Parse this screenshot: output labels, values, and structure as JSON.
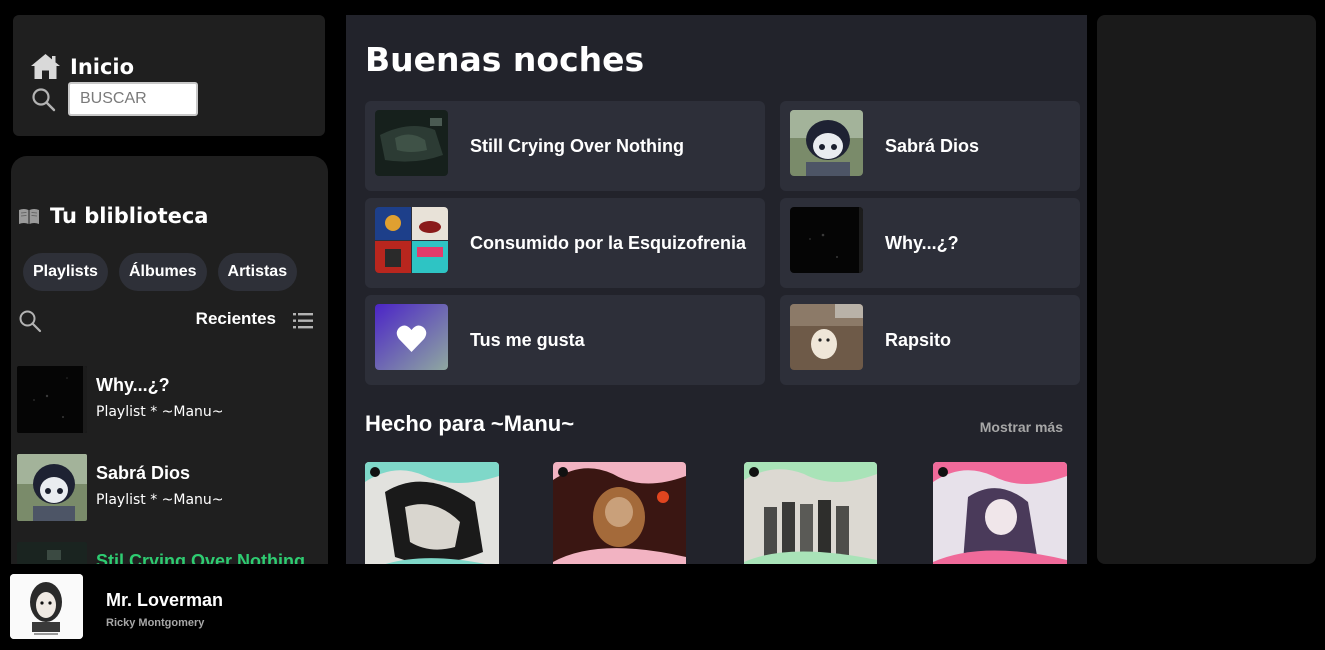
{
  "nav": {
    "home_label": "Inicio",
    "search_placeholder": "BUSCAR"
  },
  "library": {
    "title": "Tu bliblioteca",
    "filters": [
      "Playlists",
      "Álbumes",
      "Artistas"
    ],
    "sort_label": "Recientes",
    "items": [
      {
        "title": "Why...¿?",
        "subtitle": "Playlist * ~Manu~"
      },
      {
        "title": "Sabrá Dios",
        "subtitle": "Playlist * ~Manu~"
      },
      {
        "title": "Stil Crying Over Nothing",
        "subtitle": ""
      }
    ]
  },
  "main": {
    "greeting": "Buenas noches",
    "quick_picks": [
      {
        "label": "Still Crying Over Nothing"
      },
      {
        "label": "Sabrá Dios"
      },
      {
        "label": "Consumido por la Esquizofrenia"
      },
      {
        "label": "Why...¿?"
      },
      {
        "label": "Tus me gusta"
      },
      {
        "label": "Rapsito"
      }
    ],
    "made_for_title": "Hecho para ~Manu~",
    "show_more": "Mostrar más",
    "mix_count_label": ""
  },
  "now_playing": {
    "title": "Mr. Loverman",
    "artist": "Ricky Montgomery"
  },
  "colors": {
    "accent_green": "#2ecc71",
    "panel": "#1f1f1f",
    "main_bg": "#22232b",
    "card": "#2d2f39"
  }
}
